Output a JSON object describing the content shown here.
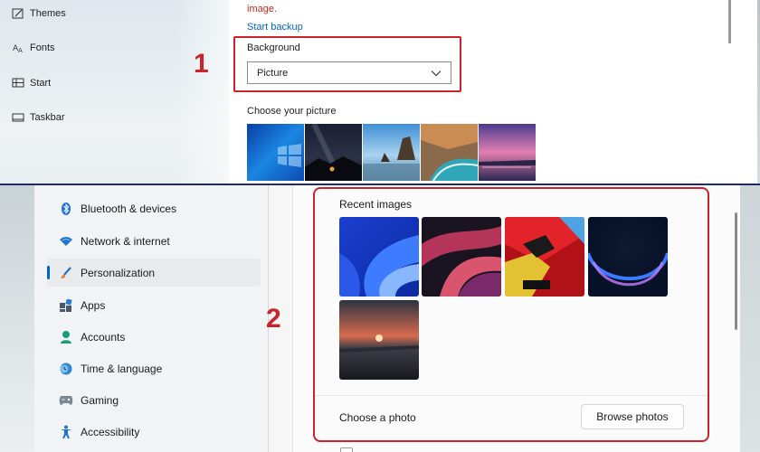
{
  "panel1": {
    "sidebar": [
      {
        "label": "Themes",
        "icon": "themes-icon"
      },
      {
        "label": "Fonts",
        "icon": "fonts-icon"
      },
      {
        "label": "Start",
        "icon": "start-icon"
      },
      {
        "label": "Taskbar",
        "icon": "taskbar-icon"
      }
    ],
    "warning_text": "image.",
    "backup_link": "Start backup",
    "background_label": "Background",
    "background_value": "Picture",
    "choose_picture_label": "Choose your picture",
    "pictures": [
      "windows-blue-wallpaper",
      "night-sky-tent",
      "beach-rocks",
      "coastal-cove",
      "pink-sunset-lake"
    ],
    "annotation_number": "1"
  },
  "panel2": {
    "sidebar": [
      {
        "label": "Bluetooth & devices",
        "icon": "bluetooth-icon"
      },
      {
        "label": "Network & internet",
        "icon": "wifi-icon"
      },
      {
        "label": "Personalization",
        "icon": "brush-icon",
        "active": true
      },
      {
        "label": "Apps",
        "icon": "apps-icon"
      },
      {
        "label": "Accounts",
        "icon": "person-icon"
      },
      {
        "label": "Time & language",
        "icon": "globe-clock-icon"
      },
      {
        "label": "Gaming",
        "icon": "gamepad-icon"
      },
      {
        "label": "Accessibility",
        "icon": "accessibility-icon"
      }
    ],
    "recent_images_label": "Recent images",
    "recent_images": [
      "blue-bloom",
      "red-swirl",
      "star-wars",
      "blue-glow",
      "lake-sunset"
    ],
    "choose_photo_label": "Choose a photo",
    "browse_button": "Browse photos",
    "annotation_number": "2"
  },
  "colors": {
    "annotation_red": "#c9232c",
    "link_blue": "#0067c0",
    "warning_red": "#c42b1c",
    "accent_blue": "#0067c0"
  }
}
